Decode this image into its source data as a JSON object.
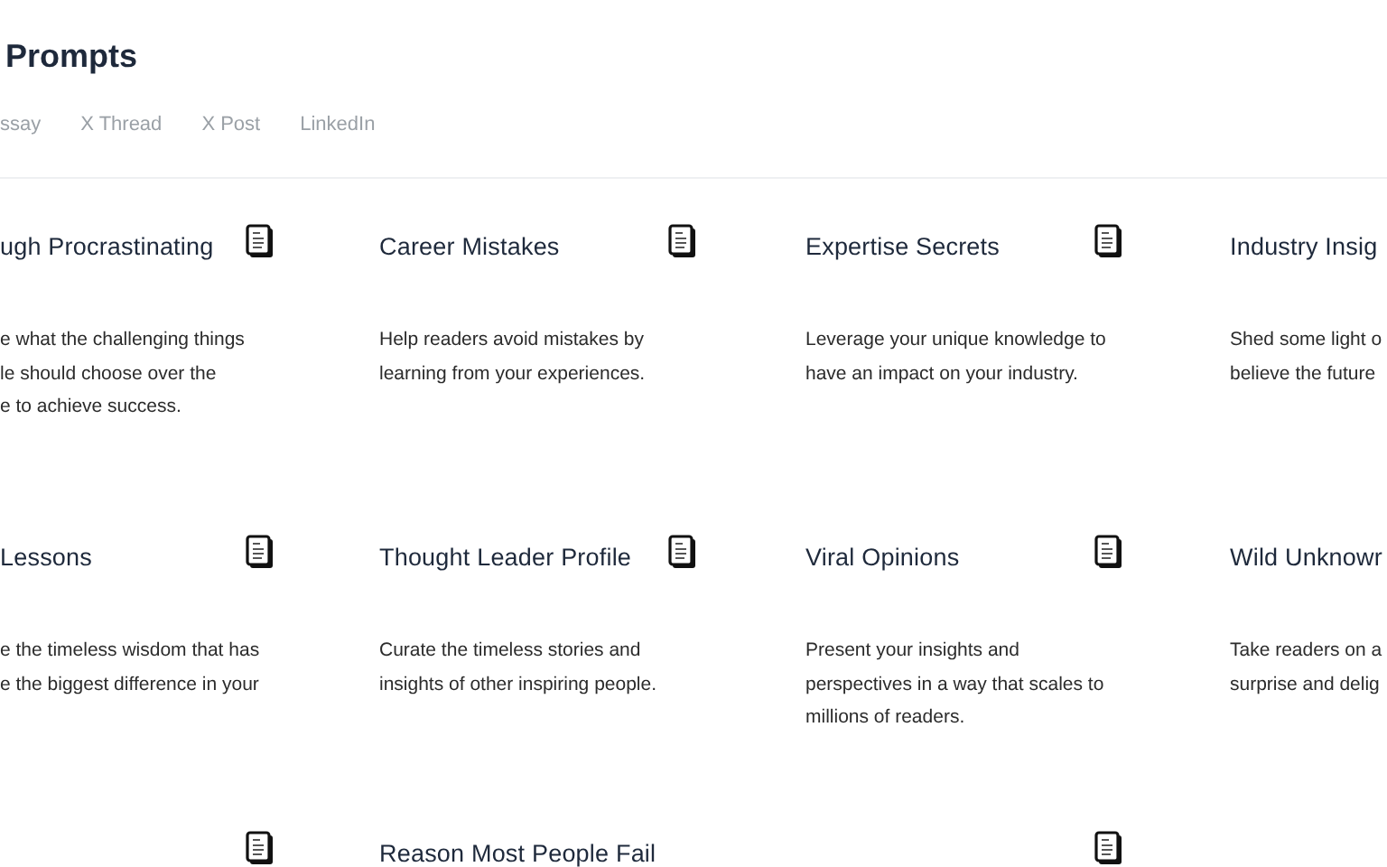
{
  "page_title": "Prompts",
  "tabs": [
    {
      "label": "ssay",
      "selected": false
    },
    {
      "label": "X Thread",
      "selected": false
    },
    {
      "label": "X Post",
      "selected": false
    },
    {
      "label": "LinkedIn",
      "selected": false
    }
  ],
  "cards": [
    {
      "title": "ugh Procrastinating",
      "icon": true,
      "description": [
        "e what the challenging things",
        "le should choose over the",
        "e to achieve success."
      ]
    },
    {
      "title": "Career Mistakes",
      "icon": true,
      "description": [
        "Help readers avoid mistakes by",
        "learning from your experiences."
      ]
    },
    {
      "title": "Expertise Secrets",
      "icon": true,
      "description": [
        "Leverage your unique knowledge to",
        "have an impact on your industry."
      ]
    },
    {
      "title": "Industry Insig",
      "icon": false,
      "description": [
        "Shed some light o",
        "believe the future"
      ]
    },
    {
      "title": "Lessons",
      "icon": true,
      "description": [
        "e the timeless wisdom that has",
        "e the biggest difference in your"
      ]
    },
    {
      "title": "Thought Leader Profile",
      "icon": true,
      "description": [
        "Curate the timeless stories and",
        "insights of other inspiring people."
      ]
    },
    {
      "title": "Viral Opinions",
      "icon": true,
      "description": [
        "Present your insights and",
        "perspectives in a way that scales to",
        "millions of readers."
      ]
    },
    {
      "title": "Wild Unknowr",
      "icon": false,
      "description": [
        "Take readers on a",
        "surprise and delig"
      ]
    },
    {
      "icon": true
    },
    {
      "title": "Reason Most People Fail",
      "icon": false
    },
    {
      "icon": true
    }
  ]
}
